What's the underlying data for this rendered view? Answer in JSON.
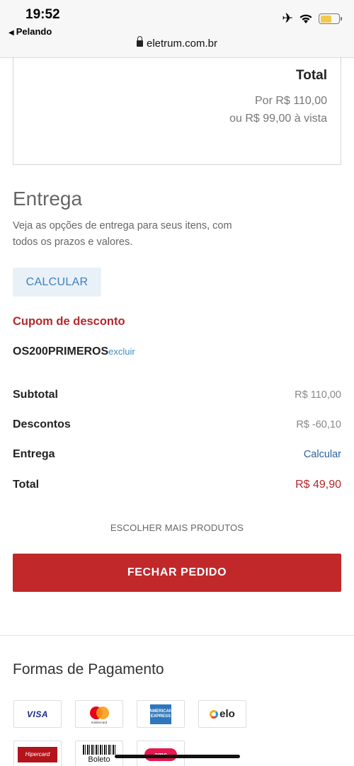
{
  "status_bar": {
    "time": "19:52",
    "back_label": "Pelando",
    "url": "eletrum.com.br",
    "battery_level": 0.6,
    "battery_color": "#f2c94c"
  },
  "summary": {
    "total_title": "Total",
    "price": "Por R$ 110,00",
    "cash_price": "ou R$ 99,00 à vista"
  },
  "shipping": {
    "title": "Entrega",
    "description": "Veja as opções de entrega para seus itens, com todos os prazos e valores.",
    "calculate_label": "CALCULAR"
  },
  "coupon": {
    "title": "Cupom de desconto",
    "code": "OS200PRIMEROS",
    "remove_label": "excluir"
  },
  "totals": [
    {
      "label": "Subtotal",
      "value": "R$ 110,00"
    },
    {
      "label": "Descontos",
      "value": "R$ -60,10"
    },
    {
      "label": "Entrega",
      "value": "Calcular"
    },
    {
      "label": "Total",
      "value": "R$ 49,90"
    }
  ],
  "actions": {
    "more_products_label": "ESCOLHER MAIS PRODUTOS",
    "checkout_label": "FECHAR PEDIDO"
  },
  "payment": {
    "title": "Formas de Pagamento",
    "methods": [
      {
        "name": "VISA",
        "icon": "visa-icon"
      },
      {
        "name": "mastercard",
        "icon": "mastercard-icon"
      },
      {
        "name": "AMERICAN EXPRESS",
        "icon": "amex-icon"
      },
      {
        "name": "elo",
        "icon": "elo-icon"
      },
      {
        "name": "Hipercard",
        "icon": "hipercard-icon"
      },
      {
        "name": "Boleto",
        "icon": "boleto-icon"
      },
      {
        "name": "ame",
        "icon": "ame-icon"
      }
    ]
  },
  "colors": {
    "accent_red": "#c0282a",
    "coupon_red": "#b3282d",
    "link_blue": "#2b5fa0",
    "calc_button_bg": "#e9f1f8"
  }
}
